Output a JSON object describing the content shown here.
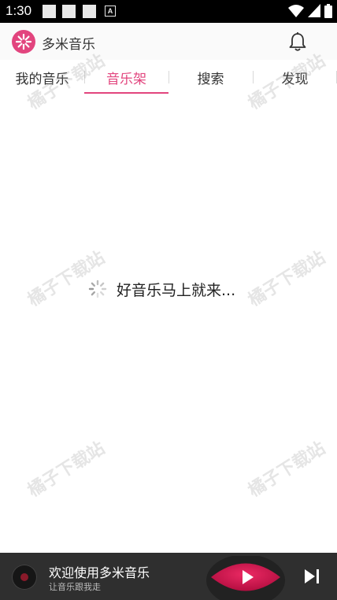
{
  "status_bar": {
    "time": "1:30",
    "notification_letter": "A"
  },
  "app_bar": {
    "title": "多米音乐"
  },
  "tabs": [
    {
      "label": "我的音乐"
    },
    {
      "label": "音乐架"
    },
    {
      "label": "搜索"
    },
    {
      "label": "发现"
    }
  ],
  "active_tab": 1,
  "main": {
    "loading_text": "好音乐马上就来..."
  },
  "watermark": "橘子下载站",
  "player": {
    "title": "欢迎使用多米音乐",
    "subtitle": "让音乐跟我走"
  },
  "colors": {
    "accent": "#e2457e",
    "play_button": "#d4154f",
    "player_bg": "#2f2f2f"
  },
  "icons": {
    "logo": "domi-logo-icon",
    "notification": "bell-icon",
    "loading": "spinner-icon",
    "play": "play-icon",
    "next": "skip-next-icon"
  }
}
